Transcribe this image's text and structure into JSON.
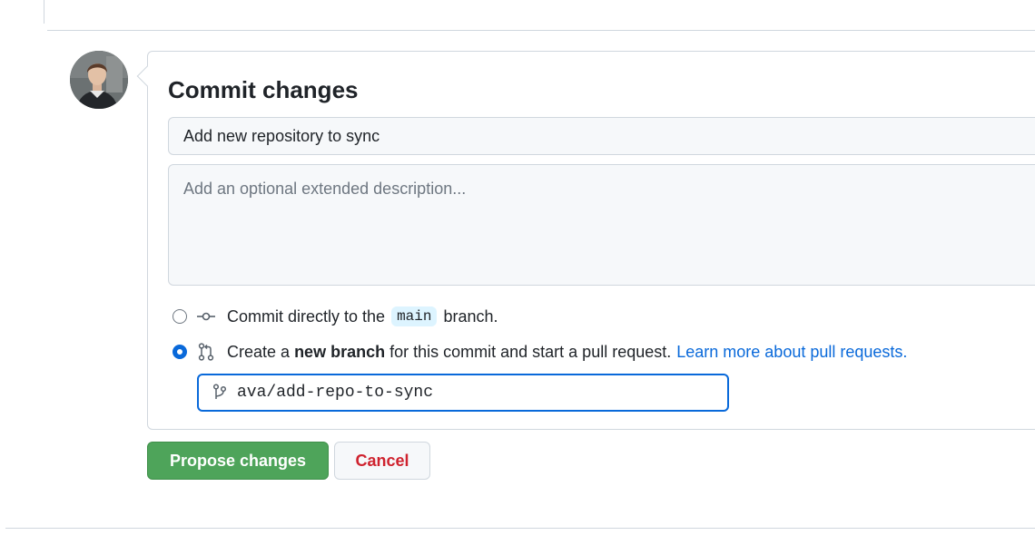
{
  "commit": {
    "title": "Commit changes",
    "summary_value": "Add new repository to sync",
    "description_placeholder": "Add an optional extended description...",
    "description_value": ""
  },
  "options": {
    "direct": {
      "text_before": "Commit directly to the",
      "branch_name": "main",
      "text_after": "branch.",
      "selected": false
    },
    "new_branch": {
      "text_before": "Create a",
      "bold_text": "new branch",
      "text_after": "for this commit and start a pull request.",
      "link_text": "Learn more about pull requests.",
      "selected": true
    }
  },
  "branch_input": {
    "value": "ava/add-repo-to-sync"
  },
  "buttons": {
    "propose_label": "Propose changes",
    "cancel_label": "Cancel"
  },
  "icons": {
    "commit": "git-commit-icon",
    "pull_request": "git-pull-request-icon",
    "branch": "git-branch-icon"
  },
  "colors": {
    "accent": "#0969da",
    "primary_button": "#4ea45a",
    "danger_text": "#cf222e",
    "code_pill_bg": "#ddf4ff"
  }
}
